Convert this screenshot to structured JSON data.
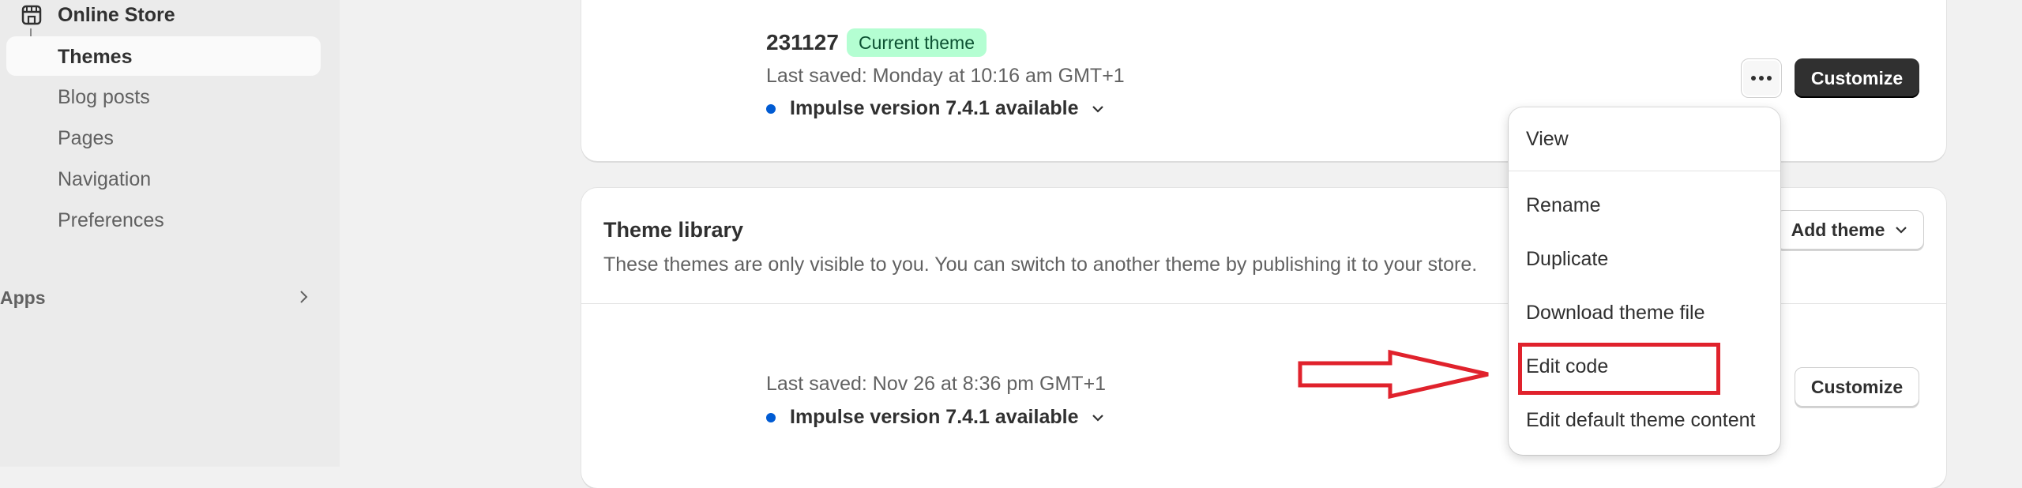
{
  "sidebar": {
    "online_store": "Online Store",
    "items": [
      {
        "label": "Themes"
      },
      {
        "label": "Blog posts"
      },
      {
        "label": "Pages"
      },
      {
        "label": "Navigation"
      },
      {
        "label": "Preferences"
      }
    ],
    "apps": "Apps"
  },
  "current_theme": {
    "name": "231127",
    "badge": "Current theme",
    "last_saved": "Last saved: Monday at 10:16 am GMT+1",
    "version": "Impulse version 7.4.1 available",
    "customize": "Customize"
  },
  "library": {
    "title": "Theme library",
    "description": "These themes are only visible to you. You can switch to another theme by publishing it to your store.",
    "add_theme": "Add theme",
    "theme": {
      "last_saved": "Last saved: Nov 26 at 8:36 pm GMT+1",
      "version": "Impulse version 7.4.1 available",
      "customize": "Customize"
    }
  },
  "menu": {
    "items": [
      "View",
      "Rename",
      "Duplicate",
      "Download theme file",
      "Edit code",
      "Edit default theme content"
    ]
  },
  "colors": {
    "badge_bg": "#b4fed2",
    "accent_dot": "#005bd3",
    "annotation_red": "#e0222c"
  }
}
